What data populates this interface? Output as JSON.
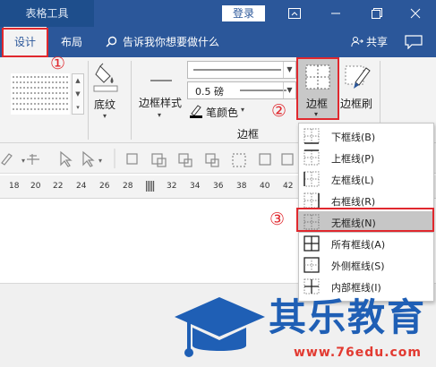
{
  "titlebar": {
    "context_tab": "表格工具",
    "login_label": "登录",
    "colors": {
      "bar": "#2b579a",
      "context": "#1e4e8c"
    }
  },
  "tabs": [
    {
      "label": "设计",
      "active": true
    },
    {
      "label": "布局",
      "active": false
    }
  ],
  "tellme": {
    "text": "告诉我你想要做什么"
  },
  "share_label": "共享",
  "ribbon": {
    "shading_label": "底纹",
    "border_styles_label": "边框样式",
    "line_weight_value": "0.5 磅",
    "pen_color_label": "笔颜色",
    "group_label": "边框",
    "borders_button_label": "边框",
    "border_painter_label": "边框刷"
  },
  "ruler": {
    "numbers": [
      "18",
      "20",
      "22",
      "24",
      "26",
      "28",
      "32",
      "34",
      "36",
      "38",
      "40",
      "42"
    ]
  },
  "dropdown": {
    "items": [
      {
        "label": "下框线(B)",
        "icon": "border-bottom-icon"
      },
      {
        "label": "上框线(P)",
        "icon": "border-top-icon"
      },
      {
        "label": "左框线(L)",
        "icon": "border-left-icon"
      },
      {
        "label": "右框线(R)",
        "icon": "border-right-icon"
      },
      {
        "label": "无框线(N)",
        "icon": "no-border-icon",
        "highlighted": true
      },
      {
        "label": "所有框线(A)",
        "icon": "all-borders-icon"
      },
      {
        "label": "外侧框线(S)",
        "icon": "outside-borders-icon"
      },
      {
        "label": "内部框线(I)",
        "icon": "inside-borders-icon"
      }
    ]
  },
  "annotations": {
    "step1": "①",
    "step2": "②",
    "step3": "③",
    "color": "#e0282e"
  },
  "watermark": {
    "brand": "其乐教育",
    "url": "www.76edu.com"
  }
}
